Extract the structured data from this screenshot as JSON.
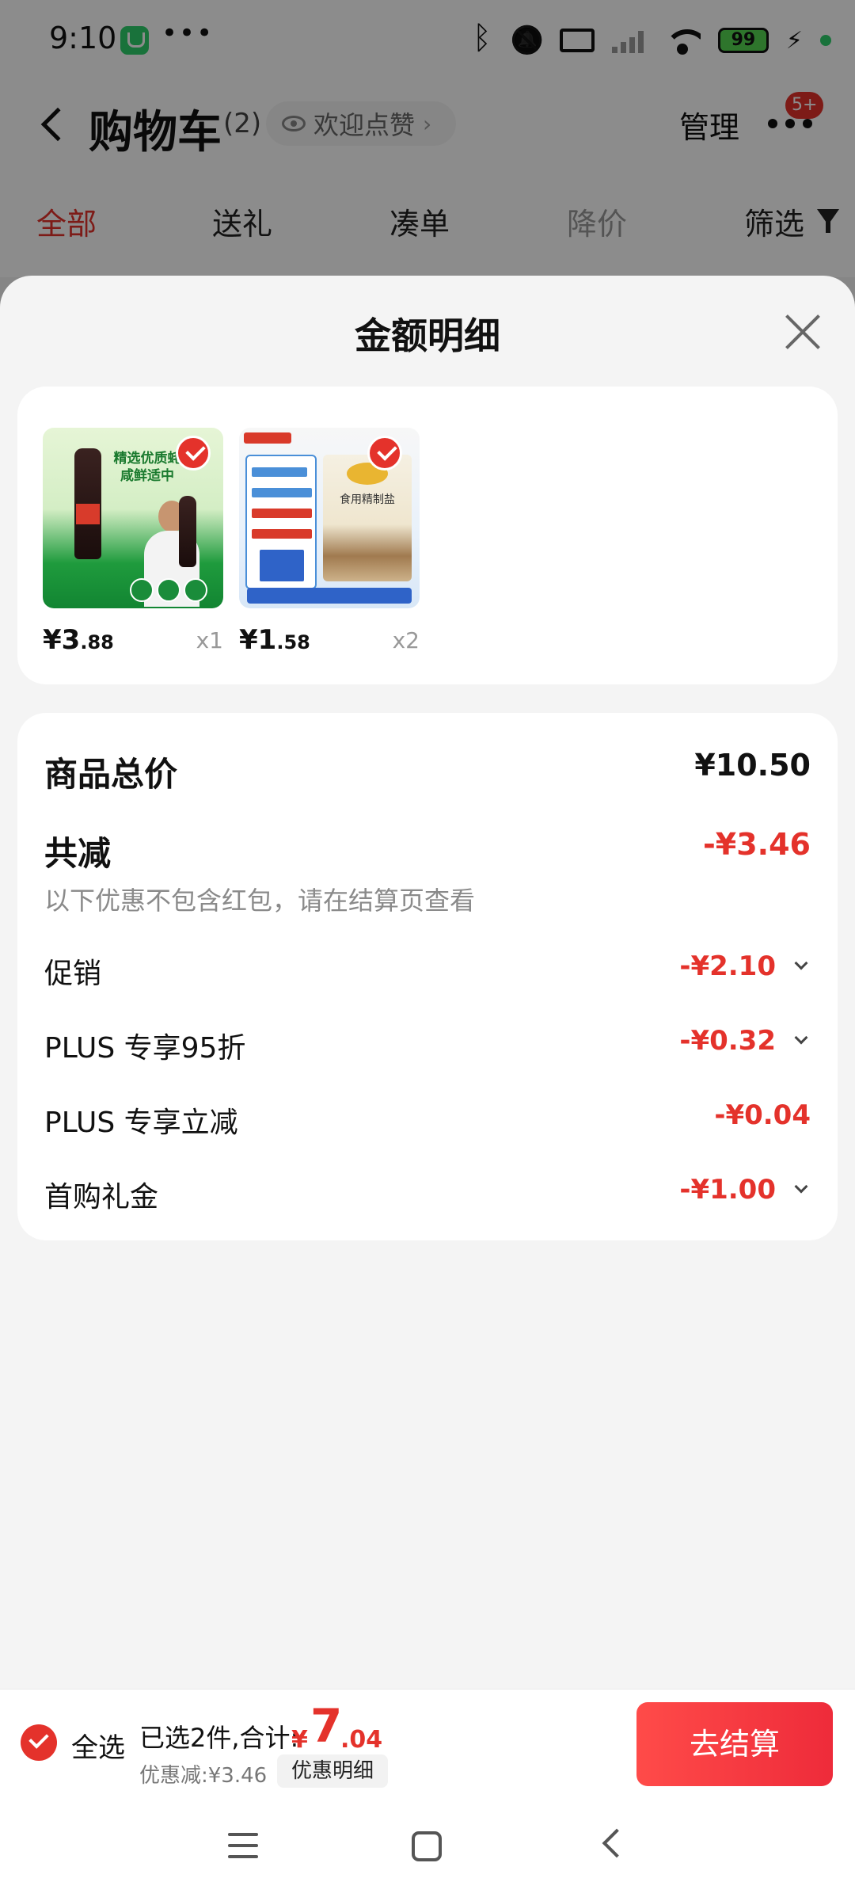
{
  "status_bar": {
    "time": "9:10",
    "dots": "•••",
    "battery": "99",
    "icons": [
      "mi-app-icon",
      "bluetooth-icon",
      "mute-icon",
      "laptop-icon",
      "signal-icon",
      "wifi-icon",
      "battery-icon",
      "charging-icon"
    ]
  },
  "cart_header": {
    "title": "购物车",
    "count": "(2)",
    "like_label": "欢迎点赞",
    "like_arrow": "›",
    "manage_label": "管理",
    "more_badge": "5+"
  },
  "cart_tabs": [
    {
      "label": "全部",
      "state": "active"
    },
    {
      "label": "送礼",
      "state": "normal"
    },
    {
      "label": "凑单",
      "state": "normal"
    },
    {
      "label": "降价",
      "state": "muted"
    },
    {
      "label": "筛选",
      "state": "normal"
    }
  ],
  "sheet": {
    "title": "金额明细",
    "products": [
      {
        "image_icon": "oyster-sauce-product-image",
        "image_headline": "精选优质蚝 咸鲜适中",
        "price_int": "¥3",
        "price_dec": ".88",
        "qty": "x1",
        "selected": true
      },
      {
        "image_icon": "salt-product-image",
        "image_headline": "食用精制盐",
        "price_int": "¥1",
        "price_dec": ".58",
        "qty": "x2",
        "selected": true
      }
    ],
    "summary": {
      "total_label": "商品总价",
      "total_value": "¥10.50",
      "reduce_label": "共减",
      "reduce_value": "-¥3.46",
      "note": "以下优惠不包含红包，请在结算页查看",
      "items": [
        {
          "label": "促销",
          "value": "-¥2.10",
          "expandable": true
        },
        {
          "label": "PLUS 专享95折",
          "value": "-¥0.32",
          "expandable": true
        },
        {
          "label": "PLUS 专享立减",
          "value": "-¥0.04",
          "expandable": false
        },
        {
          "label": "首购礼金",
          "value": "-¥1.00",
          "expandable": true
        }
      ]
    }
  },
  "action_bar": {
    "select_all_label": "全选",
    "selected_text": "已选2件,合计:",
    "total_symbol": "¥",
    "total_int": "7",
    "total_dec": ".04",
    "discount_text": "优惠减:¥3.46",
    "detail_label": "优惠明细",
    "checkout_label": "去结算"
  },
  "colors": {
    "accent_red": "#e4322b",
    "overlay": "rgba(0,0,0,0.45)",
    "sheet_bg": "#f4f4f4"
  }
}
